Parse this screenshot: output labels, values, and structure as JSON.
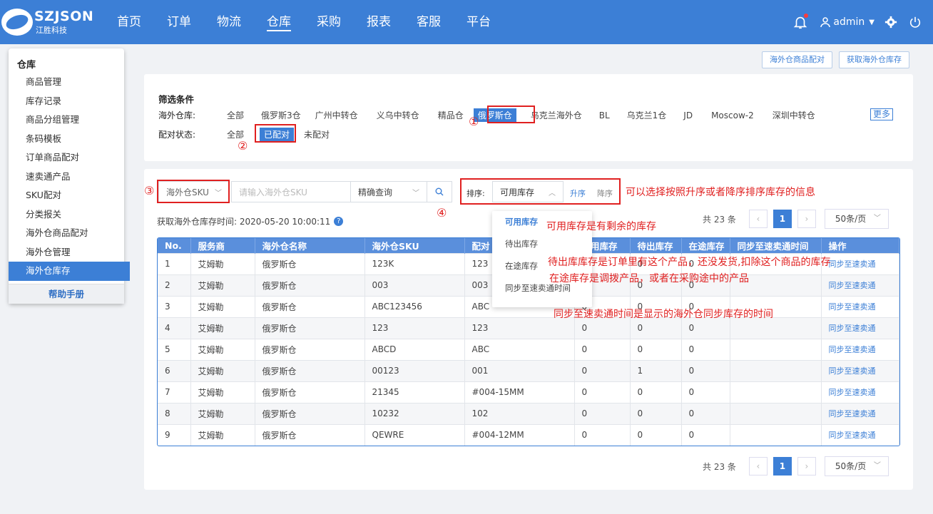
{
  "brand": {
    "name": "SZJSON",
    "sub": "江胜科技"
  },
  "nav": [
    {
      "label": "首页"
    },
    {
      "label": "订单"
    },
    {
      "label": "物流"
    },
    {
      "label": "仓库"
    },
    {
      "label": "采购"
    },
    {
      "label": "报表"
    },
    {
      "label": "客服"
    },
    {
      "label": "平台"
    }
  ],
  "nav_active": "仓库",
  "user": {
    "name": "admin"
  },
  "sidebar": {
    "title": "仓库",
    "items": [
      {
        "label": "商品管理"
      },
      {
        "label": "库存记录"
      },
      {
        "label": "商品分组管理"
      },
      {
        "label": "条码模板"
      },
      {
        "label": "订单商品配对"
      },
      {
        "label": "速卖通产品"
      },
      {
        "label": "SKU配对"
      },
      {
        "label": "分类报关"
      },
      {
        "label": "海外仓商品配对"
      },
      {
        "label": "海外仓管理"
      },
      {
        "label": "海外仓库存"
      }
    ],
    "active": "海外仓库存",
    "help": "帮助手册"
  },
  "top_buttons": {
    "pair": "海外仓商品配对",
    "fetch": "获取海外仓库存"
  },
  "filter": {
    "title": "筛选条件",
    "warehouse_label": "海外仓库:",
    "warehouses": [
      "全部",
      "俄罗斯3仓",
      "广州中转仓",
      "义乌中转仓",
      "精品仓",
      "俄罗斯仓",
      "乌克兰海外仓",
      "BL",
      "乌克兰1仓",
      "JD",
      "Moscow-2",
      "深圳中转仓"
    ],
    "warehouse_selected": "俄罗斯仓",
    "more": "更多",
    "pair_label": "配对状态:",
    "pair_options": [
      "全部",
      "已配对",
      "未配对"
    ],
    "pair_selected": "已配对"
  },
  "search": {
    "field": "海外仓SKU",
    "placeholder": "请输入海外仓SKU",
    "mode": "精确查询",
    "sort_label": "排序:",
    "sort_value": "可用库存",
    "asc": "升序",
    "desc": "降序"
  },
  "sort_dropdown": [
    "可用库存",
    "待出库存",
    "在途库存",
    "同步至速卖通时间"
  ],
  "fetch_time": "获取海外仓库存时间: 2020-05-20 10:00:11",
  "pager": {
    "total": "共 23 条",
    "page": "1",
    "size": "50条/页"
  },
  "annotations": {
    "n1": "①",
    "n2": "②",
    "n3": "③",
    "n4": "④",
    "sort_note": "可以选择按照升序或者降序排序库存的信息",
    "available_note": "可用库存是有剩余的库存",
    "pending_note": "待出库库存是订单里有这个产品，还没发货,扣除这个商品的库存",
    "transit_note": "在途库存是调拨产品，或者在采购途中的产品",
    "sync_note": "同步至速卖通时间是显示的海外仓同步库存的时间"
  },
  "table": {
    "headers": [
      "No.",
      "服务商",
      "海外仓名称",
      "海外仓SKU",
      "配对",
      "可用库存",
      "待出库存",
      "在途库存",
      "同步至速卖通时间",
      "操作"
    ],
    "rows": [
      [
        "1",
        "艾姆勒",
        "俄罗斯仓",
        "123K",
        "123",
        "0",
        "0",
        "0",
        "",
        "同步至速卖通"
      ],
      [
        "2",
        "艾姆勒",
        "俄罗斯仓",
        "003",
        "003",
        "0",
        "0",
        "0",
        "",
        "同步至速卖通"
      ],
      [
        "3",
        "艾姆勒",
        "俄罗斯仓",
        "ABC123456",
        "ABC",
        "0",
        "0",
        "0",
        "",
        "同步至速卖通"
      ],
      [
        "4",
        "艾姆勒",
        "俄罗斯仓",
        "123",
        "123",
        "0",
        "0",
        "0",
        "",
        "同步至速卖通"
      ],
      [
        "5",
        "艾姆勒",
        "俄罗斯仓",
        "ABCD",
        "ABC",
        "0",
        "0",
        "0",
        "",
        "同步至速卖通"
      ],
      [
        "6",
        "艾姆勒",
        "俄罗斯仓",
        "00123",
        "001",
        "0",
        "1",
        "0",
        "",
        "同步至速卖通"
      ],
      [
        "7",
        "艾姆勒",
        "俄罗斯仓",
        "21345",
        "#004-15MM",
        "0",
        "0",
        "0",
        "",
        "同步至速卖通"
      ],
      [
        "8",
        "艾姆勒",
        "俄罗斯仓",
        "10232",
        "102",
        "0",
        "0",
        "0",
        "",
        "同步至速卖通"
      ],
      [
        "9",
        "艾姆勒",
        "俄罗斯仓",
        "QEWRE",
        "#004-12MM",
        "0",
        "0",
        "0",
        "",
        "同步至速卖通"
      ]
    ]
  },
  "colors": {
    "primary": "#3c7fd6",
    "annotation": "#e02020"
  }
}
